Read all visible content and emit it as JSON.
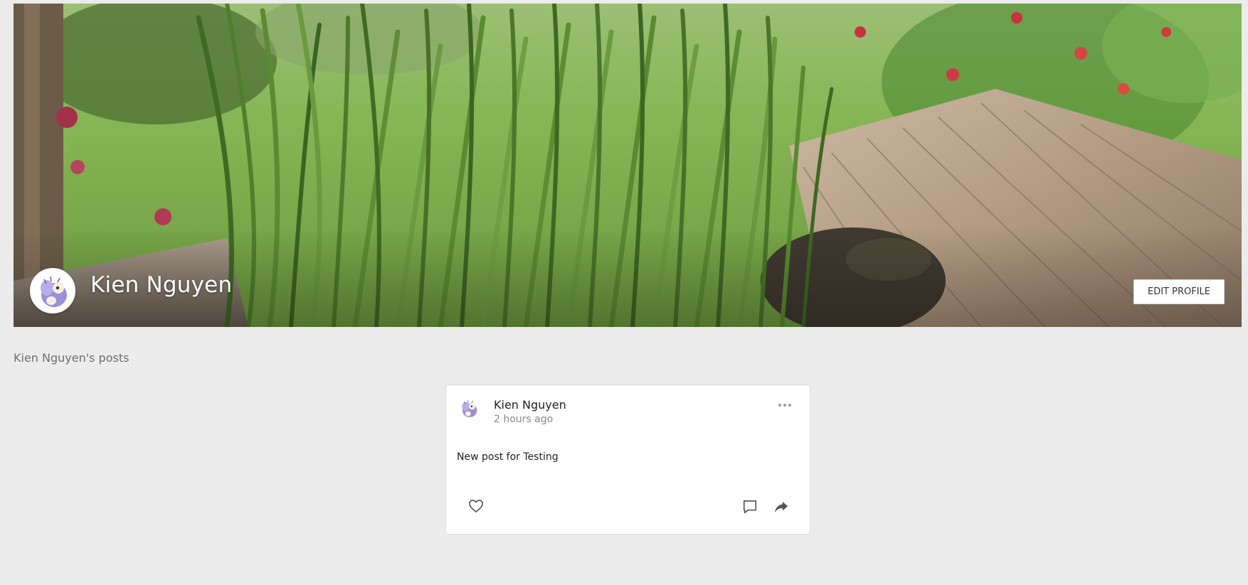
{
  "profile": {
    "name": "Kien Nguyen",
    "edit_label": "EDIT PROFILE"
  },
  "posts_section": {
    "heading": "Kien Nguyen's posts"
  },
  "post": {
    "author": "Kien Nguyen",
    "time": "2 hours ago",
    "body": "New post for Testing",
    "icons": {
      "menu": "more-horizontal-icon",
      "like": "heart-outline-icon",
      "comment": "comment-icon",
      "share": "share-arrow-icon"
    }
  },
  "colors": {
    "page_background": "#ececec",
    "card_background": "#ffffff",
    "avatar_accent": "#9b8fd8"
  }
}
